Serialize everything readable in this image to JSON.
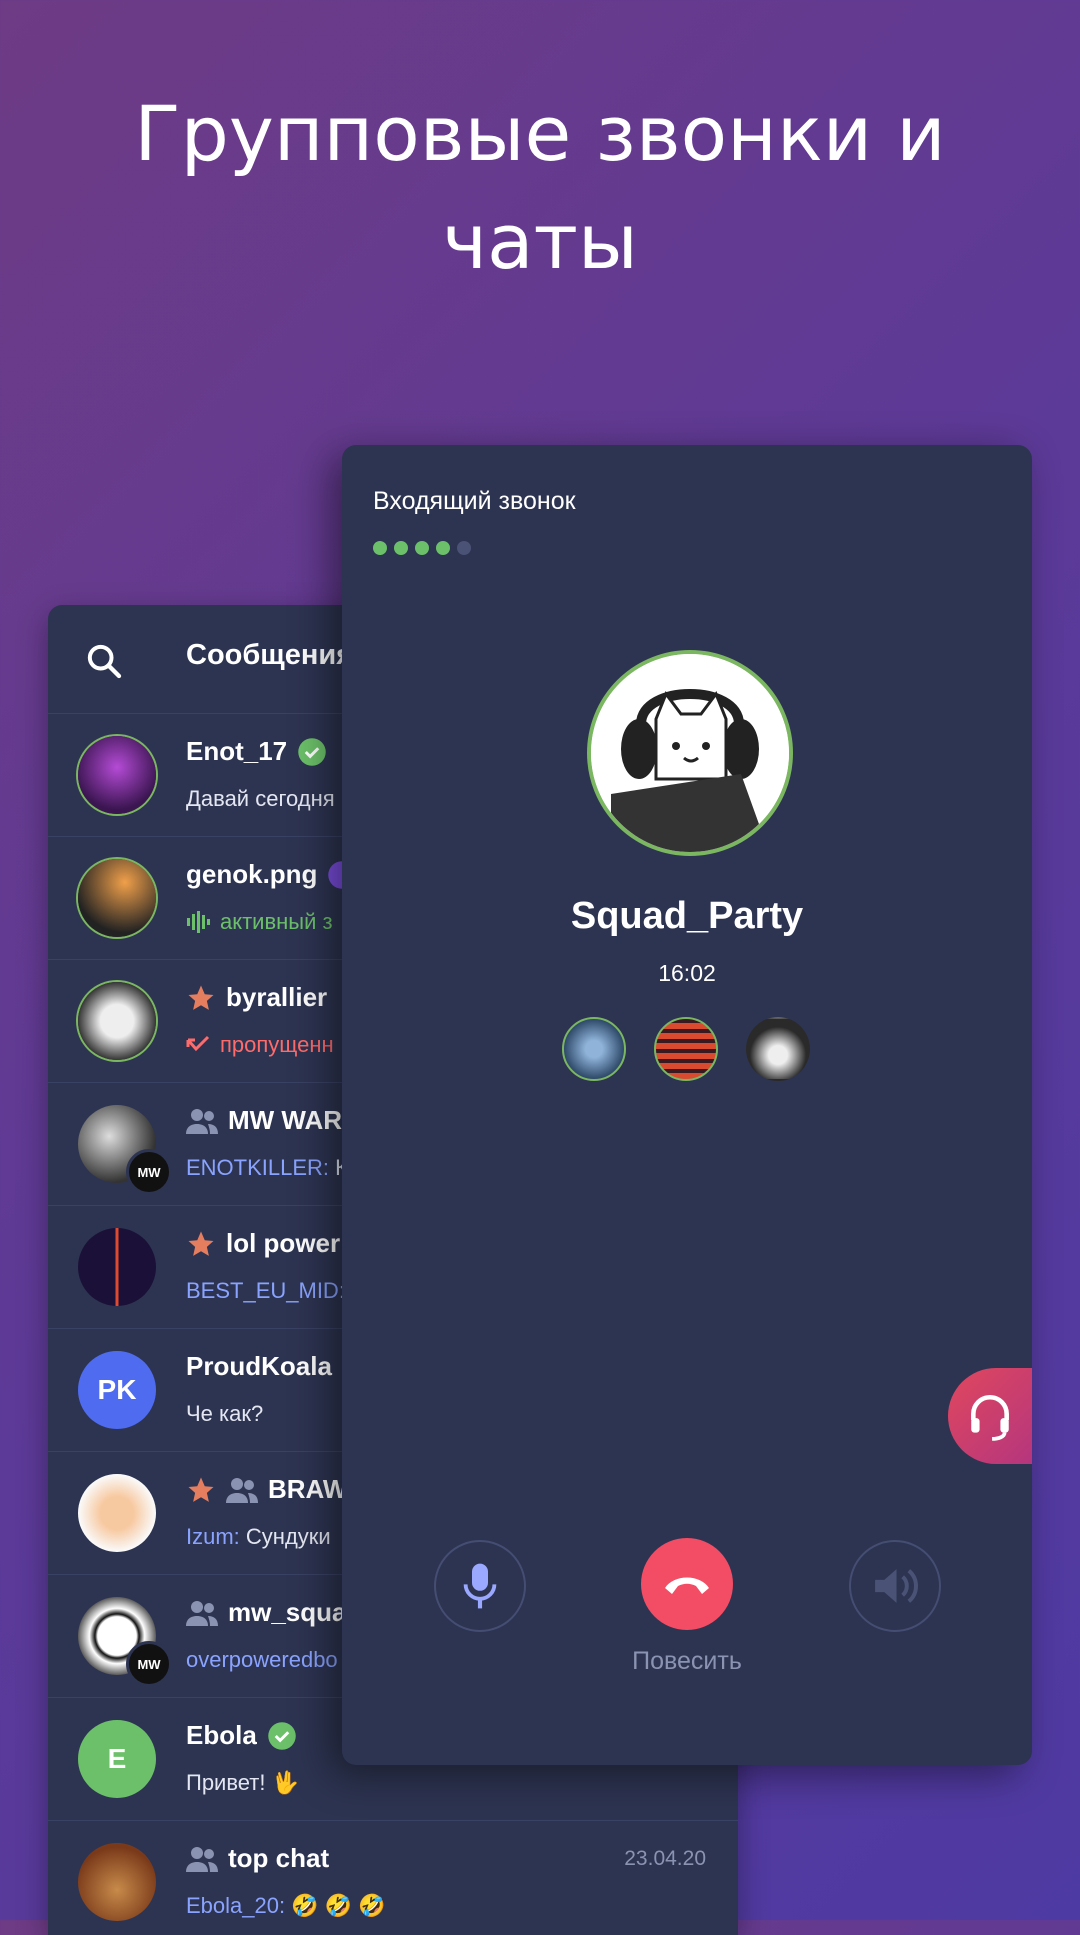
{
  "headline": {
    "line1": "Групповые звонки и",
    "line2": "чаты"
  },
  "chat_list": {
    "title": "Сообщения",
    "rows": [
      {
        "name": "Enot_17",
        "preview": "Давай сегодня",
        "badge": "verified"
      },
      {
        "name": "genok.png",
        "preview": "активный з",
        "icon": "voice-wave-icon"
      },
      {
        "name": "byrallier",
        "preview": "пропущенн",
        "icon": "missed-call-icon"
      },
      {
        "name": "MW WAR",
        "sender": "ENOTKILLER:",
        "preview": "К",
        "avatar_badge": "MW"
      },
      {
        "name": "lol power",
        "sender": "BEST_EU_MID:",
        "preview": ""
      },
      {
        "name": "ProudKoala",
        "preview": "Че как?",
        "initials": "PK"
      },
      {
        "name": "BRAW",
        "sender": "Izum:",
        "preview": "Сундуки"
      },
      {
        "name": "mw_squa",
        "sender": "overpoweredbo",
        "preview": "",
        "avatar_badge": "MW"
      },
      {
        "name": "Ebola",
        "preview": "Привет! 🖖",
        "initials": "E"
      },
      {
        "name": "top chat",
        "sender": "Ebola_20:",
        "preview": "🤣 🤣 🤣",
        "date": "23.04.20"
      }
    ]
  },
  "call": {
    "status": "Входящий звонок",
    "name": "Squad_Party",
    "time": "16:02",
    "hangup_label": "Повесить"
  },
  "colors": {
    "panel": "#2d3451",
    "accent_green": "#6cc06a",
    "hangup_red": "#f24d64",
    "sender_blue": "#8aa3ff"
  }
}
